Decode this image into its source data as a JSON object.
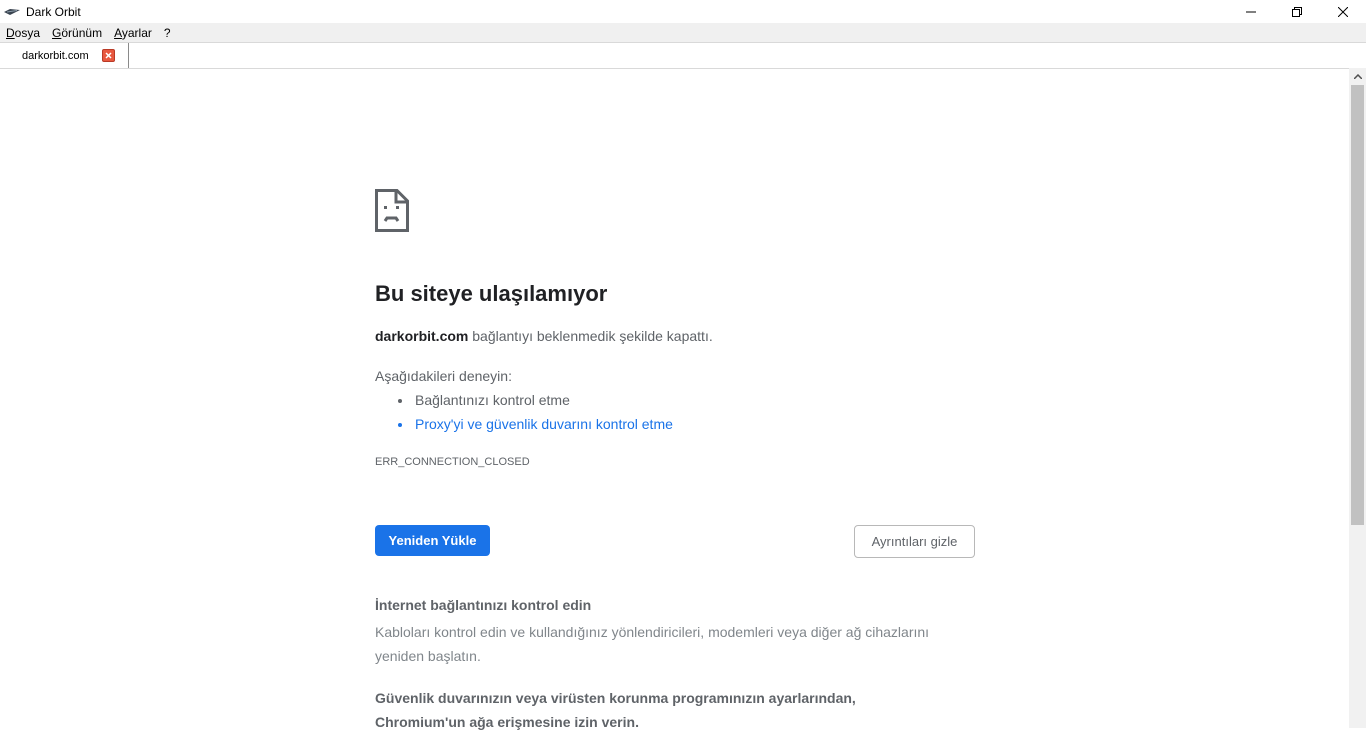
{
  "window": {
    "title": "Dark Orbit",
    "controls": {
      "minimize": "—",
      "restore": "❐",
      "close": "✕"
    }
  },
  "menu": {
    "items": [
      {
        "label": "Dosya"
      },
      {
        "label": "Görünüm"
      },
      {
        "label": "Ayarlar"
      },
      {
        "label": "?"
      }
    ]
  },
  "tabs": [
    {
      "label": "darkorbit.com",
      "close_icon": "close-icon",
      "close_color": "#e8583f"
    }
  ],
  "error_page": {
    "icon": "sad-page-icon",
    "heading": "Bu siteye ulaşılamıyor",
    "host": "darkorbit.com",
    "description": " bağlantıyı beklenmedik şekilde kapattı.",
    "try_label": "Aşağıdakileri deneyin:",
    "suggestions": [
      {
        "text": "Bağlantınızı kontrol etme"
      },
      {
        "text": "Proxy'yi ve güvenlik duvarını kontrol etme"
      }
    ],
    "error_code": "ERR_CONNECTION_CLOSED",
    "reload_label": "Yeniden Yükle",
    "details_label": "Ayrıntıları gizle",
    "details": [
      {
        "title": "İnternet bağlantınızı kontrol edin",
        "body": "Kabloları kontrol edin ve kullandığınız yönlendiricileri, modemleri veya diğer ağ cihazlarını yeniden başlatın."
      },
      {
        "title": "Güvenlik duvarınızın veya virüsten korunma programınızın ayarlarından, Chromium'un ağa erişmesine izin verin."
      }
    ]
  },
  "colors": {
    "primary": "#1a73e8",
    "text_dark": "#202124",
    "text_muted": "#5f6368"
  }
}
